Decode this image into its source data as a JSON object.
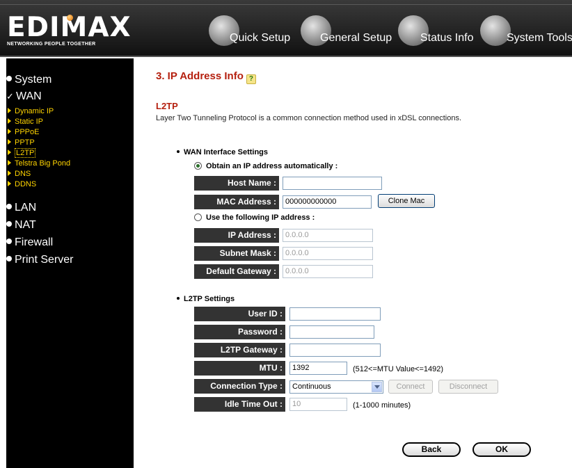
{
  "logo": {
    "brand": "EDIMAX",
    "tagline": "NETWORKING PEOPLE TOGETHER"
  },
  "nav": {
    "quick_setup": "Quick Setup",
    "general_setup": "General Setup",
    "status_info": "Status Info",
    "system_tools": "System Tools"
  },
  "sidebar": {
    "system": "System",
    "wan": "WAN",
    "wan_items": [
      "Dynamic IP",
      "Static IP",
      "PPPoE",
      "PPTP",
      "L2TP",
      "Telstra Big Pond",
      "DNS",
      "DDNS"
    ],
    "lan": "LAN",
    "nat": "NAT",
    "firewall": "Firewall",
    "print_server": "Print Server"
  },
  "page": {
    "title": "3. IP Address Info",
    "section_title": "L2TP",
    "section_desc": "Layer Two Tunneling Protocol is a common connection method used in xDSL connections."
  },
  "wan_settings": {
    "heading": "WAN Interface Settings",
    "auto_label": "Obtain an IP address automatically :",
    "host_name_label": "Host Name :",
    "host_name_value": "",
    "mac_label": "MAC Address :",
    "mac_value": "000000000000",
    "clone_mac": "Clone Mac",
    "manual_label": "Use the following IP address :",
    "ip_label": "IP Address :",
    "ip_value": "0.0.0.0",
    "subnet_label": "Subnet Mask :",
    "subnet_value": "0.0.0.0",
    "gateway_label": "Default Gateway :",
    "gateway_value": "0.0.0.0"
  },
  "l2tp_settings": {
    "heading": "L2TP Settings",
    "user_id_label": "User ID :",
    "user_id_value": "",
    "password_label": "Password :",
    "password_value": "",
    "gateway_label": "L2TP Gateway :",
    "gateway_value": "",
    "mtu_label": "MTU :",
    "mtu_value": "1392",
    "mtu_note": "(512<=MTU Value<=1492)",
    "conn_type_label": "Connection Type :",
    "conn_type_value": "Continuous",
    "connect": "Connect",
    "disconnect": "Disconnect",
    "idle_label": "Idle Time Out :",
    "idle_value": "10",
    "idle_note": "(1-1000 minutes)"
  },
  "actions": {
    "back": "Back",
    "ok": "OK"
  },
  "colors": {
    "title_red": "#b5200f",
    "menu_yellow": "#ffd400",
    "label_bg": "#333333"
  }
}
